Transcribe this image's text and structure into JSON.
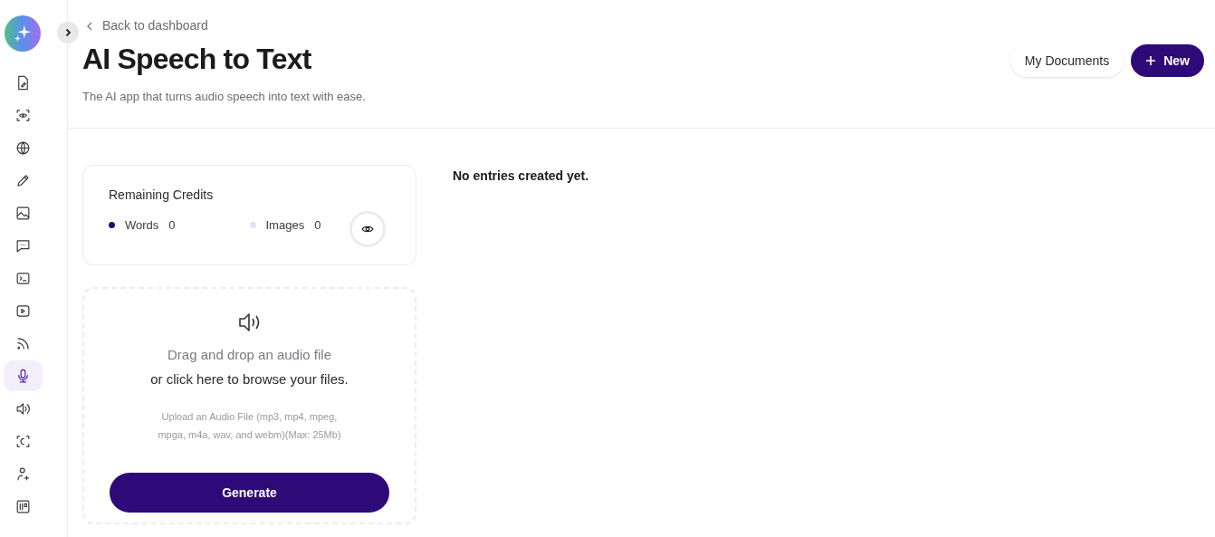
{
  "sidebar": {
    "items": [
      {
        "selected": false
      },
      {
        "selected": false
      },
      {
        "selected": false
      },
      {
        "selected": false
      },
      {
        "selected": false
      },
      {
        "selected": false
      },
      {
        "selected": false
      },
      {
        "selected": false
      },
      {
        "selected": false
      },
      {
        "selected": true
      },
      {
        "selected": false
      },
      {
        "selected": false
      },
      {
        "selected": false
      },
      {
        "selected": false
      }
    ]
  },
  "header": {
    "back_link": "Back to dashboard",
    "title": "AI Speech to Text",
    "subtitle": "The AI app that turns audio speech into text with ease.",
    "buttons": [
      {
        "kind": "secondary",
        "label": "My Documents"
      },
      {
        "kind": "primary",
        "label": "New"
      }
    ]
  },
  "credits": {
    "title": "Remaining Credits",
    "items": [
      {
        "label": "Words",
        "value": "0",
        "color": "#2d0a73"
      },
      {
        "label": "Images",
        "value": "0",
        "color": "#ecdff8"
      }
    ]
  },
  "upload": {
    "line_1": "Drag and drop an audio file",
    "line_2": "or click here to browse your files.",
    "hint": "Upload an Audio File (mp3, mp4, mpeg, mpga, m4a, wav, and webm)(Max: 25Mb)",
    "button": "Generate"
  },
  "entries": {
    "empty_text": "No entries created yet."
  }
}
